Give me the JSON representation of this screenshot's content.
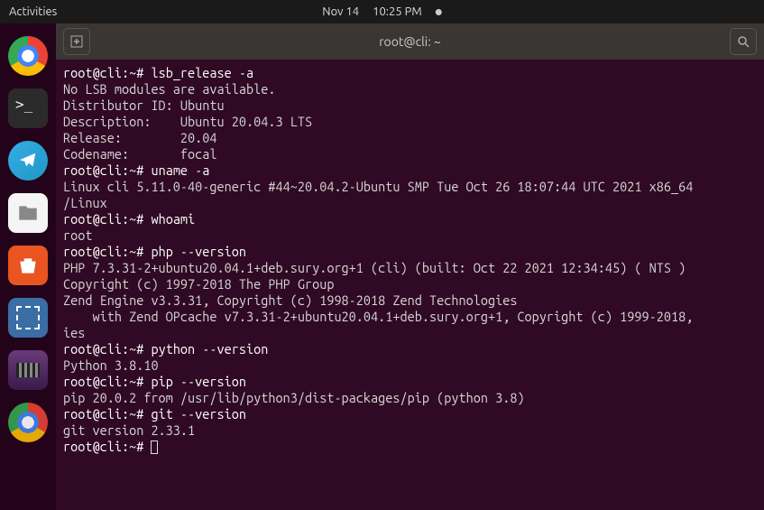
{
  "topbar": {
    "activities": "Activities",
    "date": "Nov 14",
    "time": "10:25 PM"
  },
  "dock": {
    "items": [
      "chrome-icon",
      "terminal-icon",
      "telegram-icon",
      "files-icon",
      "software-center-icon",
      "screenshot-icon",
      "video-player-icon",
      "chrome-icon-2"
    ]
  },
  "terminal": {
    "window_title": "root@cli: ~",
    "prompt": "root@cli:~#",
    "lines": [
      {
        "t": "cmd",
        "p": "root@cli:~# ",
        "c": "lsb_release -a"
      },
      {
        "t": "out",
        "c": "No LSB modules are available."
      },
      {
        "t": "out",
        "c": "Distributor ID: Ubuntu"
      },
      {
        "t": "out",
        "c": "Description:    Ubuntu 20.04.3 LTS"
      },
      {
        "t": "out",
        "c": "Release:        20.04"
      },
      {
        "t": "out",
        "c": "Codename:       focal"
      },
      {
        "t": "cmd",
        "p": "root@cli:~# ",
        "c": "uname -a"
      },
      {
        "t": "out",
        "c": "Linux cli 5.11.0-40-generic #44~20.04.2-Ubuntu SMP Tue Oct 26 18:07:44 UTC 2021 x86_64"
      },
      {
        "t": "out",
        "c": "/Linux"
      },
      {
        "t": "cmd",
        "p": "root@cli:~# ",
        "c": "whoami"
      },
      {
        "t": "out",
        "c": "root"
      },
      {
        "t": "cmd",
        "p": "root@cli:~# ",
        "c": "php --version"
      },
      {
        "t": "out",
        "c": "PHP 7.3.31-2+ubuntu20.04.1+deb.sury.org+1 (cli) (built: Oct 22 2021 12:34:45) ( NTS )"
      },
      {
        "t": "out",
        "c": "Copyright (c) 1997-2018 The PHP Group"
      },
      {
        "t": "out",
        "c": "Zend Engine v3.3.31, Copyright (c) 1998-2018 Zend Technologies"
      },
      {
        "t": "out",
        "c": "    with Zend OPcache v7.3.31-2+ubuntu20.04.1+deb.sury.org+1, Copyright (c) 1999-2018,"
      },
      {
        "t": "out",
        "c": "ies"
      },
      {
        "t": "cmd",
        "p": "root@cli:~# ",
        "c": "python --version"
      },
      {
        "t": "out",
        "c": "Python 3.8.10"
      },
      {
        "t": "cmd",
        "p": "root@cli:~# ",
        "c": "pip --version"
      },
      {
        "t": "out",
        "c": "pip 20.0.2 from /usr/lib/python3/dist-packages/pip (python 3.8)"
      },
      {
        "t": "cmd",
        "p": "root@cli:~# ",
        "c": "git --version"
      },
      {
        "t": "out",
        "c": "git version 2.33.1"
      },
      {
        "t": "cmd",
        "p": "root@cli:~# ",
        "c": "",
        "cursor": true
      }
    ]
  }
}
